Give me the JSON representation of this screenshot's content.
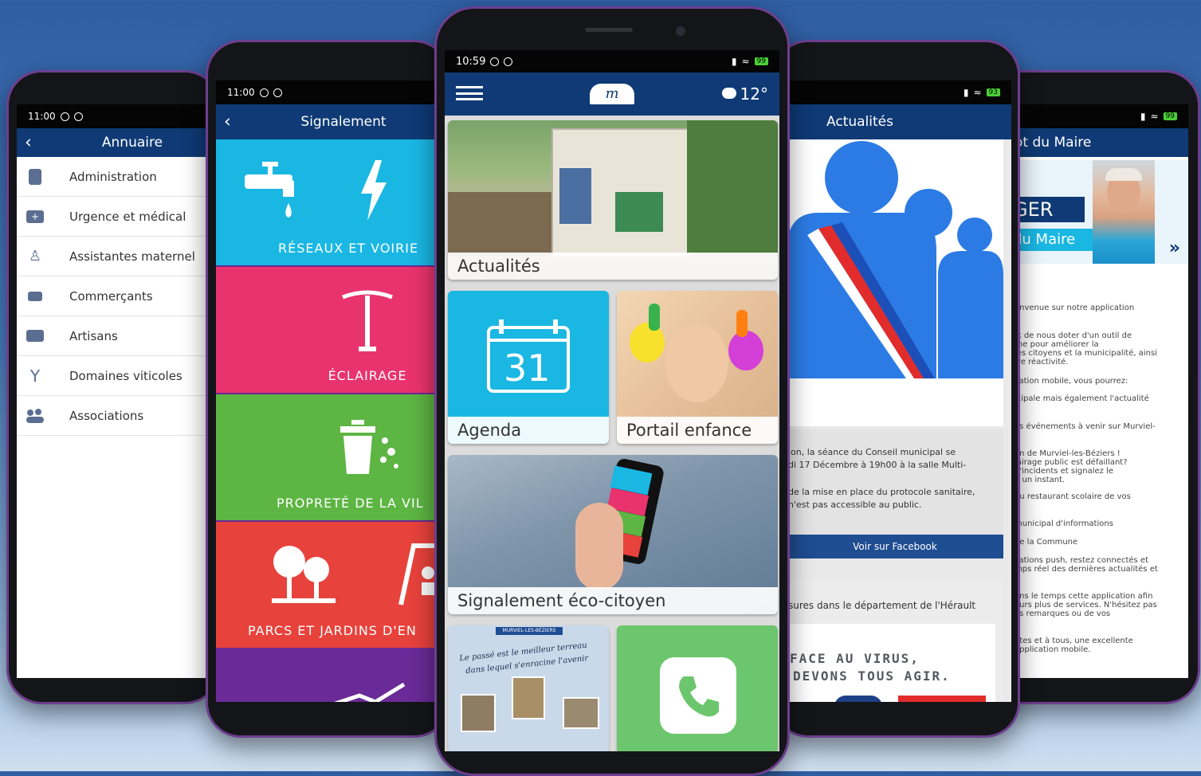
{
  "annuaire": {
    "time": "11:00",
    "title": "Annuaire",
    "items": [
      {
        "label": "Administration",
        "icon": "building-icon"
      },
      {
        "label": "Urgence et médical",
        "icon": "medical-kit-icon"
      },
      {
        "label": "Assistantes maternel",
        "icon": "baby-icon"
      },
      {
        "label": "Commerçants",
        "icon": "cart-icon"
      },
      {
        "label": "Artisans",
        "icon": "briefcase-icon"
      },
      {
        "label": "Domaines viticoles",
        "icon": "wine-glass-icon"
      },
      {
        "label": "Associations",
        "icon": "group-icon"
      }
    ]
  },
  "signalement": {
    "time": "11:00",
    "title": "Signalement",
    "tiles": [
      {
        "label": "RÉSEAUX ET VOIRIE",
        "color": "#1ab7e3"
      },
      {
        "label": "ÉCLAIRAGE",
        "color": "#e9336e"
      },
      {
        "label": "PROPRETÉ DE LA VIL",
        "color": "#5db543"
      },
      {
        "label": "PARCS ET JARDINS D'EN",
        "color": "#e8423c"
      },
      {
        "label": "",
        "color": "#6a2a97"
      }
    ]
  },
  "home": {
    "time": "10:59",
    "battery": "99",
    "temperature": "12°",
    "logo": "m",
    "cards": [
      {
        "label": "Actualités"
      },
      {
        "label": "Agenda",
        "number": "31"
      },
      {
        "label": "Portail enfance"
      },
      {
        "label": "Signalement éco-citoyen"
      }
    ],
    "heritage_banner": "MURVIEL-LES-BÉZIERS",
    "heritage_quote_1": "Le passé est le meilleur terreau",
    "heritage_quote_2": "dans lequel s'enracine l'avenir"
  },
  "actualites": {
    "title": "Actualités",
    "battery": "93",
    "post_line_1": "ion, la séance du Conseil municipal se",
    "post_line_2": "di 17 Décembre à 19h00 à la salle Multi-",
    "post_line_3": "de la mise en place du protocole sanitaire,",
    "post_line_4": "n'est pas accessible au public.",
    "facebook_button": "Voir sur Facebook",
    "post2_line": "sures dans le département de l'Hérault",
    "virus_line_1": "FACE AU VIRUS,",
    "virus_line_2": "DEVONS TOUS AGIR."
  },
  "maire": {
    "title": "ot du Maire",
    "battery": "99",
    "name_fragment": "GER",
    "role_fragment": "du Maire",
    "lines": [
      "envenue sur notre application",
      "ix de nous doter d'un outil de",
      "rne pour améliorer la",
      "les citoyens et la municipalité, ainsi",
      "tre réactivité.",
      "cation mobile, vous pourrez:",
      "icipale mais également l'actualité",
      "es événements à venir sur Murviel-",
      "en de Murviel-les-Béziers !",
      "lairage public est défaillant?",
      "d'incidents et signalez le",
      "n un instant.",
      "du restaurant scolaire de vos",
      "municipal d'informations",
      "de la Commune",
      "cations push, restez connectés et",
      "mps réel des dernières actualités et",
      "ans le temps cette application afin",
      "ours plus de services. N'hésitez pas",
      "os remarques ou de vos",
      "utes et à tous, une excellente",
      "application mobile."
    ]
  }
}
